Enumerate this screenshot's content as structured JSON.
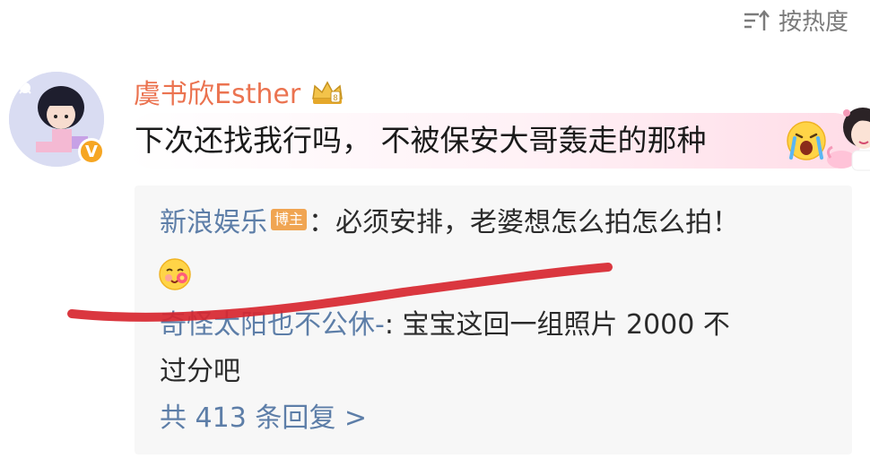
{
  "sort": {
    "icon": "sort-icon",
    "label": "按热度"
  },
  "comment": {
    "username": "虞书欣Esther",
    "badge_icon": "crown-badge-icon",
    "verified_icon": "verified-v-icon",
    "verified_label": "V",
    "text": "下次还找我行吗，  不被保安大哥轰走的那种",
    "emoji": "crying-emoji",
    "sticker": "girl-sticker"
  },
  "replies": [
    {
      "author": "新浪娱乐",
      "tag": "博主",
      "text": "：必须安排，老婆想怎么拍怎么拍！",
      "emoji": "flower-smile-emoji"
    },
    {
      "author": "奇怪太阳也不公休-",
      "text_line1": ": 宝宝这回一组照片 2000 不",
      "text_line2": "过分吧"
    }
  ],
  "more_replies": "共 413 条回复 >",
  "colors": {
    "username": "#eb7350",
    "link": "#5d7ea8",
    "annotation": "#d7262f"
  }
}
